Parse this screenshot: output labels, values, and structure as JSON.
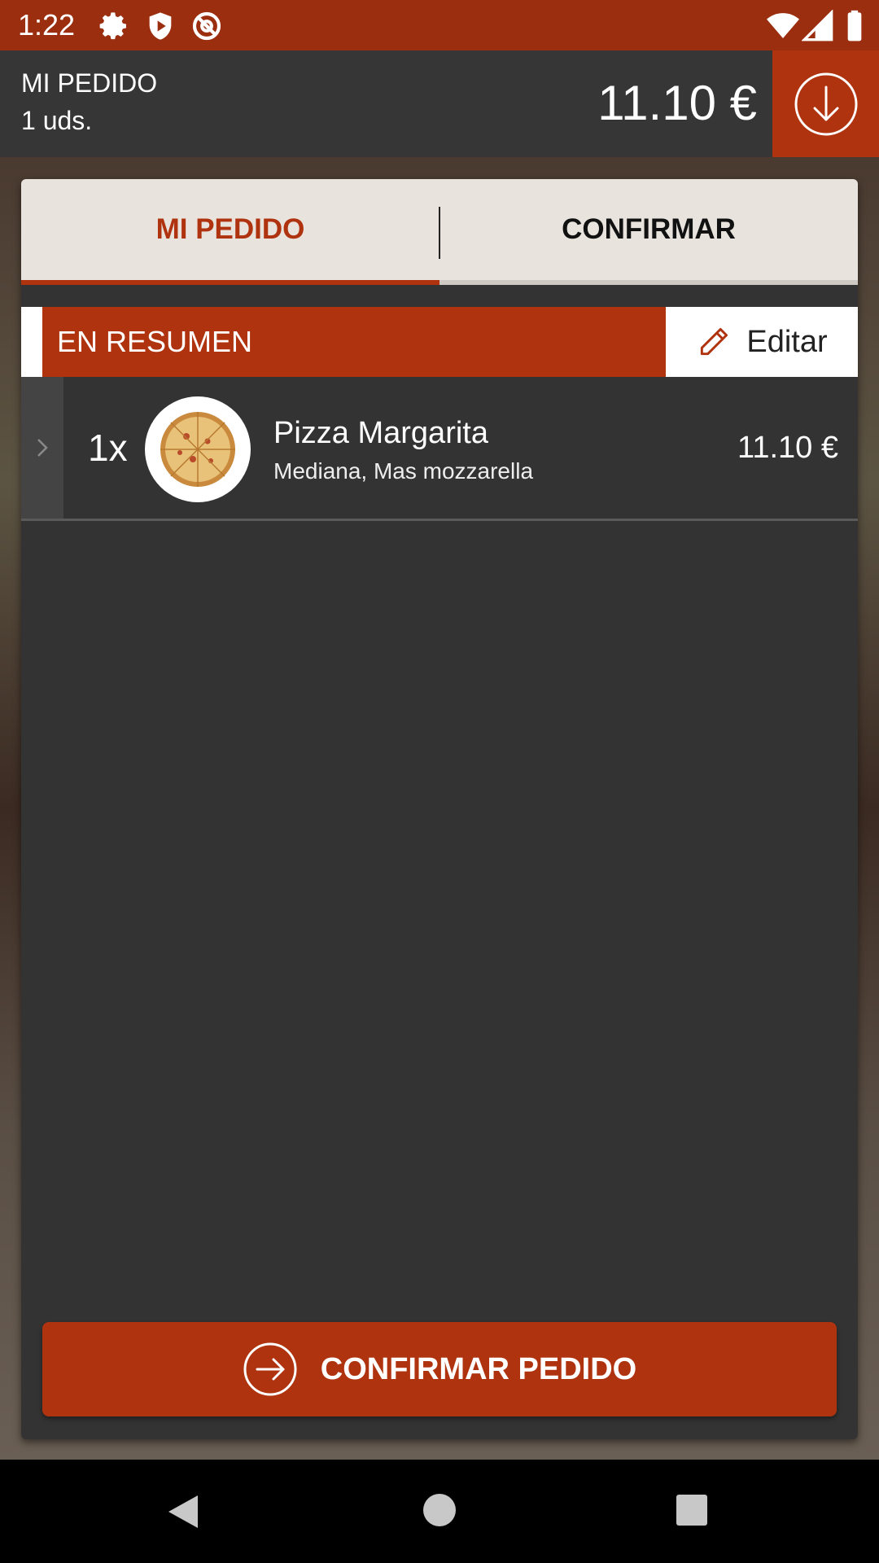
{
  "status_bar": {
    "time": "1:22",
    "icons": [
      "settings-icon",
      "shield-icon",
      "at-icon",
      "wifi-icon",
      "signal-icon",
      "battery-icon"
    ]
  },
  "order_header": {
    "title": "MI PEDIDO",
    "units": "1 uds.",
    "total": "11.10 €",
    "collapse_icon": "arrow-down-circle-icon"
  },
  "tabs": [
    {
      "label": "MI PEDIDO",
      "active": true
    },
    {
      "label": "CONFIRMAR",
      "active": false
    }
  ],
  "summary": {
    "label": "EN RESUMEN",
    "edit_label": "Editar",
    "edit_icon": "pencil-icon"
  },
  "items": [
    {
      "qty": "1x",
      "name": "Pizza Margarita",
      "options": "Mediana, Mas mozzarella",
      "price": "11.10 €",
      "image_icon": "pizza-icon"
    }
  ],
  "confirm_button": {
    "label": "CONFIRMAR PEDIDO",
    "icon": "arrow-right-circle-icon"
  },
  "colors": {
    "brand": "#b0330f",
    "status_bar": "#9a2e0f",
    "header_bg": "#363636",
    "card_bg": "#333333",
    "tab_bg": "#e8e3dd"
  }
}
